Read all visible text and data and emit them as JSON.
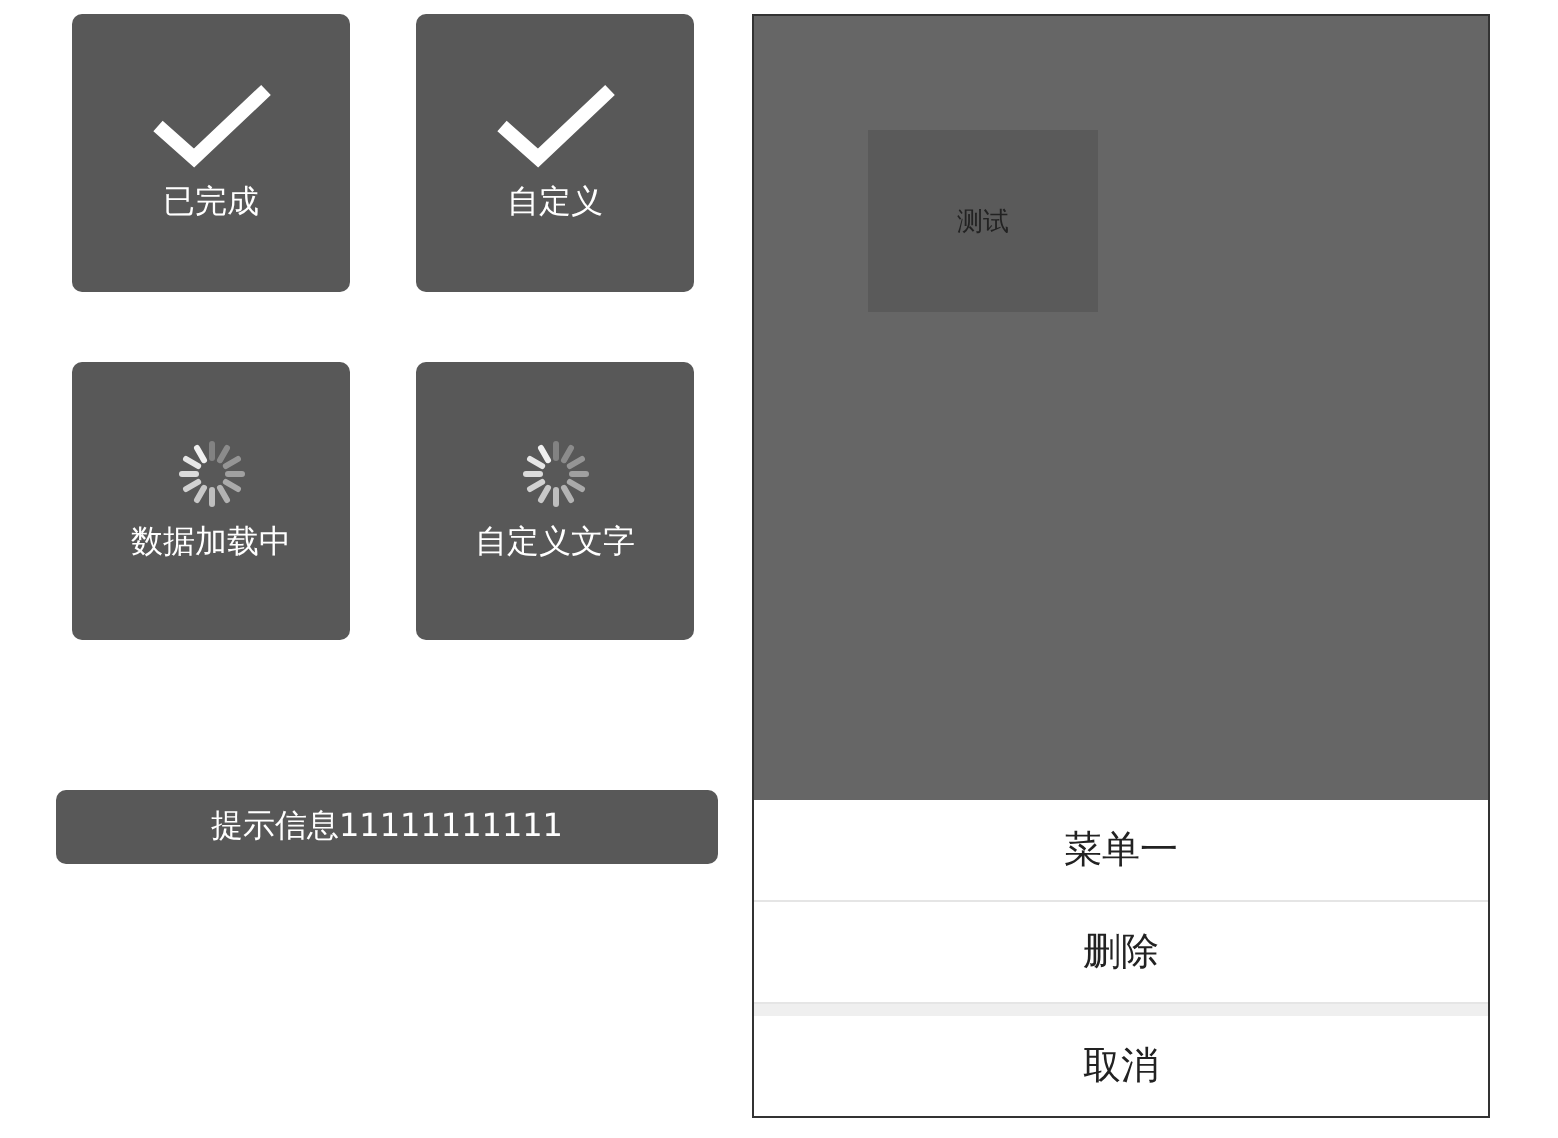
{
  "toasts": [
    {
      "kind": "success",
      "label": "已完成"
    },
    {
      "kind": "success",
      "label": "自定义"
    },
    {
      "kind": "loading",
      "label": "数据加载中"
    },
    {
      "kind": "loading",
      "label": "自定义文字"
    }
  ],
  "tip": "提示信息11111111111",
  "preview": {
    "box_label": "测试"
  },
  "action_sheet": {
    "items": [
      "菜单一",
      "删除"
    ],
    "cancel": "取消"
  }
}
